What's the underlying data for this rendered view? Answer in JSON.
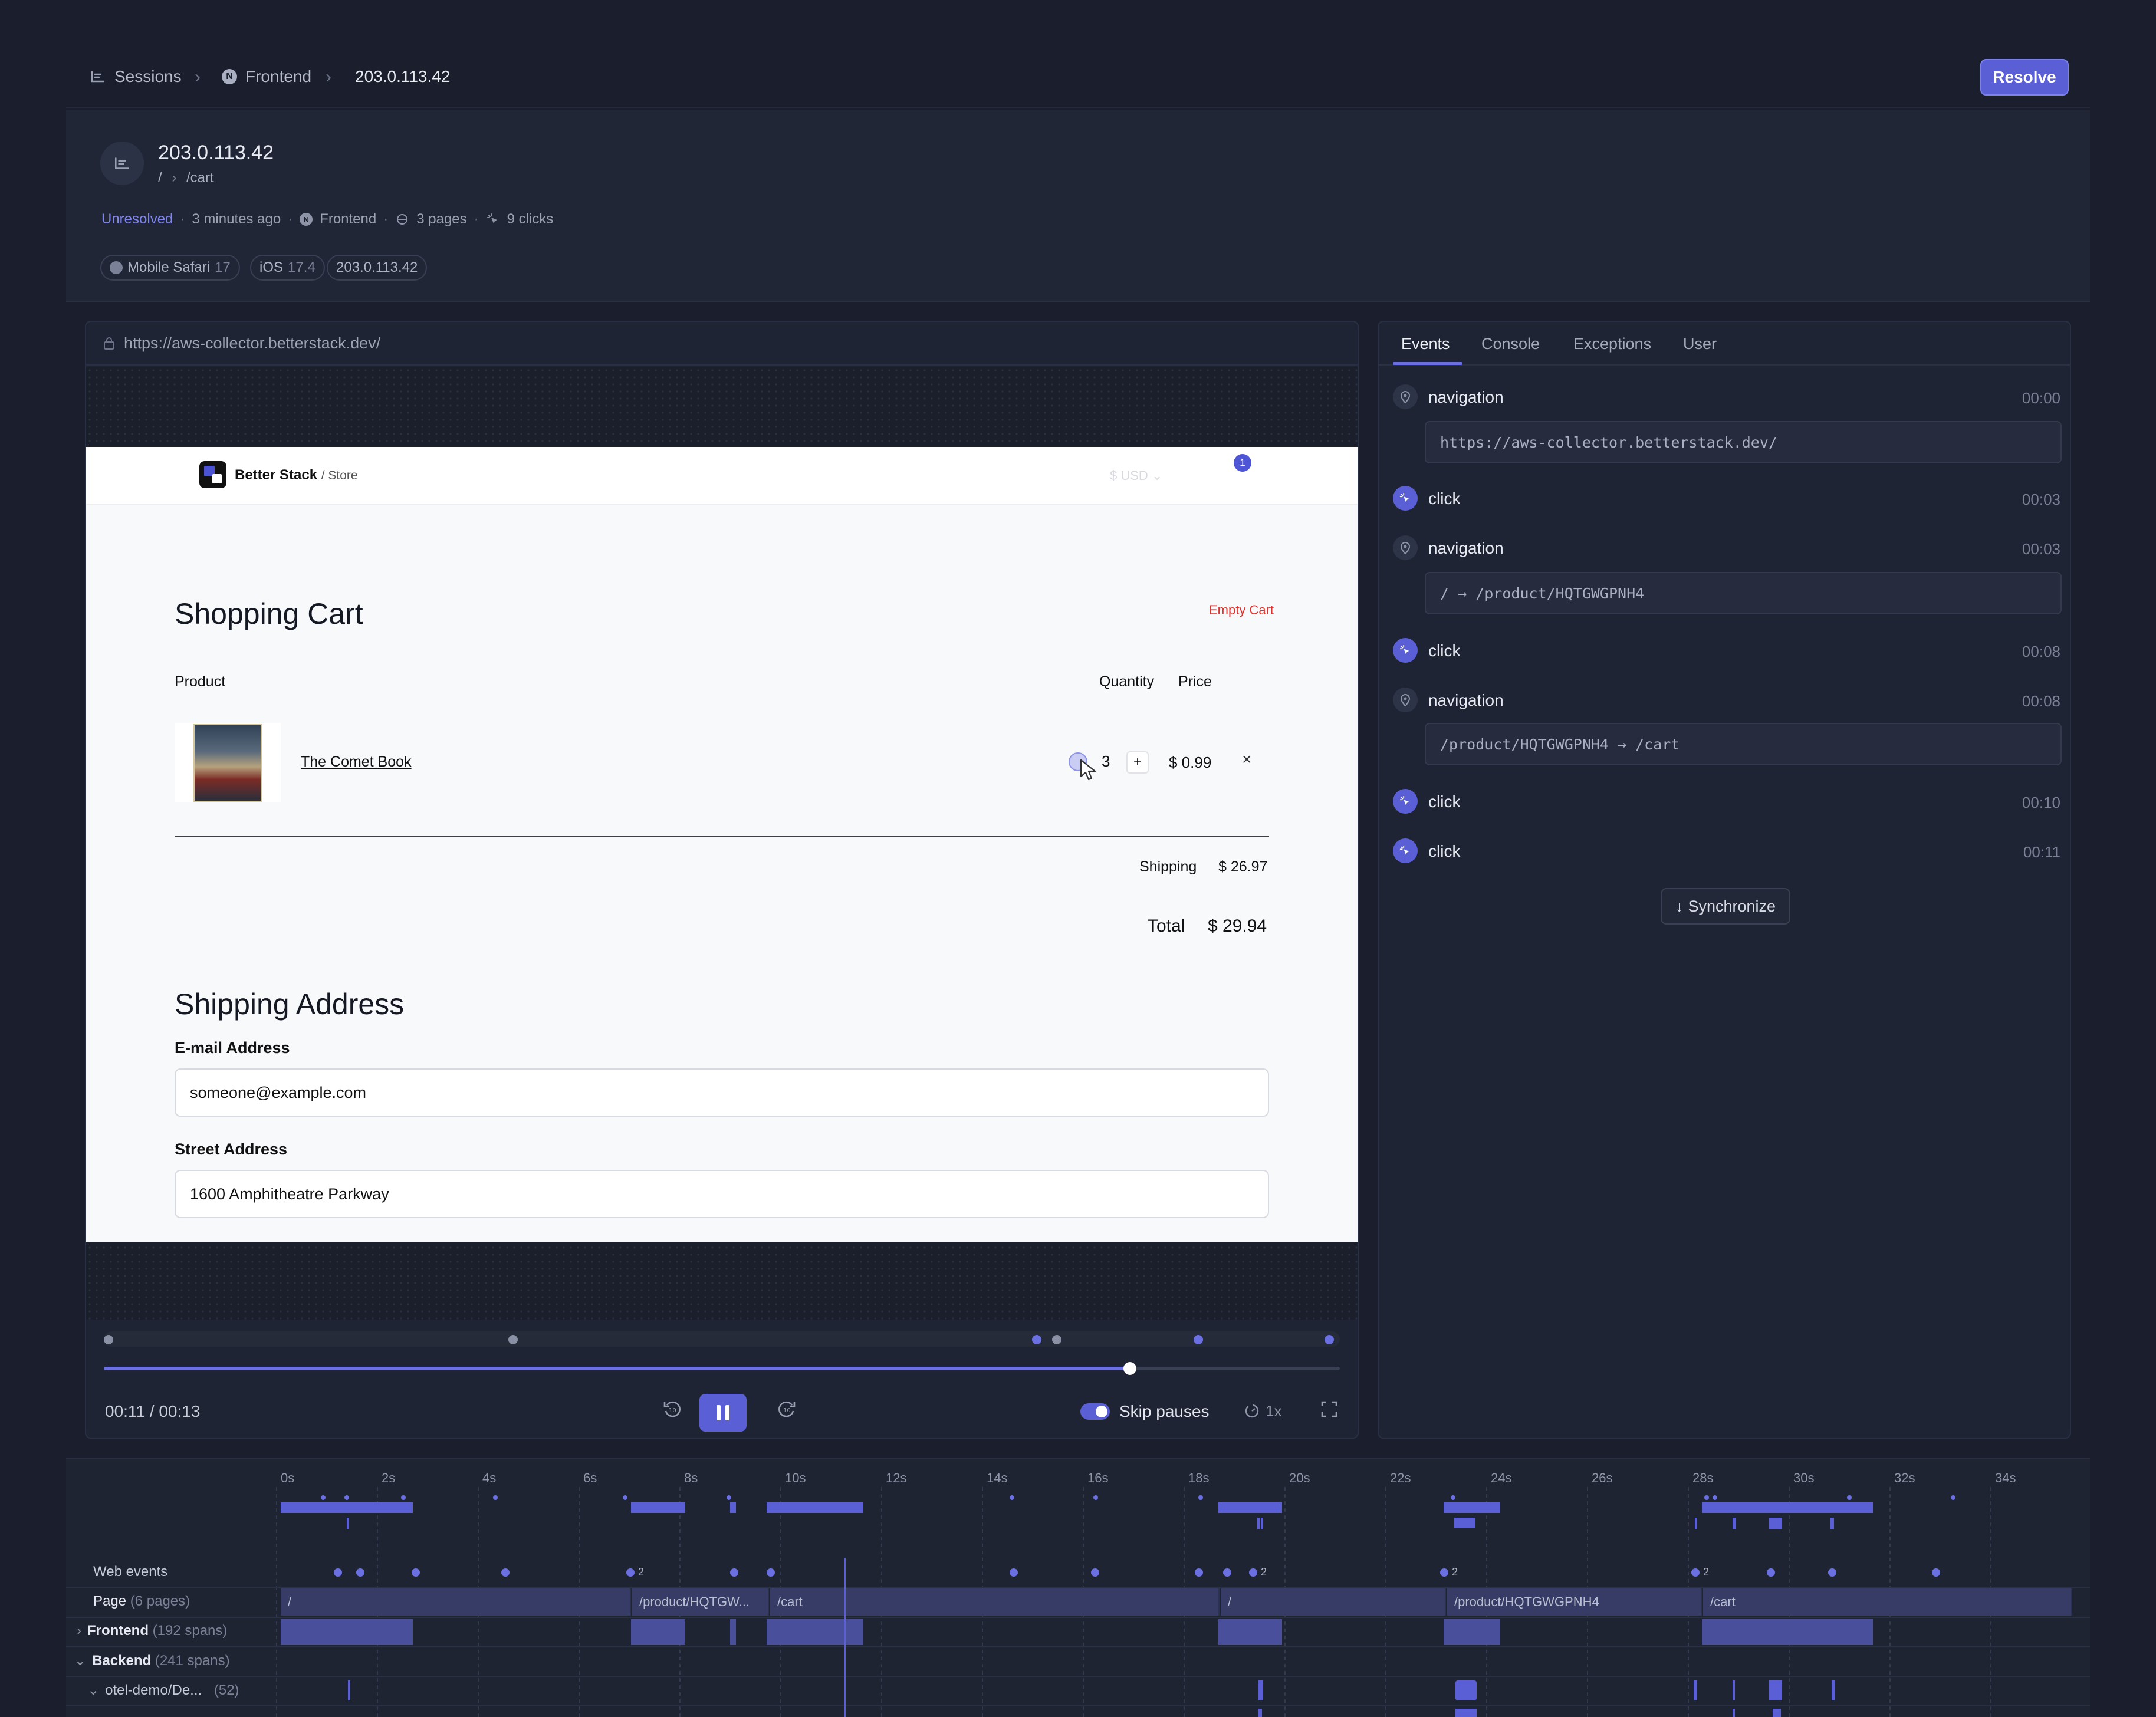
{
  "breadcrumb": {
    "sessions": "Sessions",
    "project": "Frontend",
    "project_initial": "N",
    "current": "203.0.113.42"
  },
  "resolve_label": "Resolve",
  "header": {
    "title": "203.0.113.42",
    "path_root": "/",
    "path_sep": "›",
    "path_current": "/cart",
    "status": "Unresolved",
    "time_ago": "3 minutes ago",
    "project": "Frontend",
    "pages": "3 pages",
    "clicks": "9 clicks",
    "chips": [
      {
        "name": "Mobile Safari",
        "version": "17"
      },
      {
        "name": "iOS",
        "version": "17.4"
      },
      {
        "name": "203.0.113.42",
        "version": ""
      }
    ]
  },
  "player": {
    "url": "https://aws-collector.betterstack.dev/",
    "time": "00:11 / 00:13",
    "skip_pauses": "Skip pauses",
    "speed": "1x",
    "progress": 0.83
  },
  "store": {
    "brand": "Better Stack",
    "brand_sub": "/ Store",
    "currency": "$   USD   ⌄",
    "cart_count": "1",
    "cart_title": "Shopping Cart",
    "empty_cart": "Empty Cart",
    "col_product": "Product",
    "col_quantity": "Quantity",
    "col_price": "Price",
    "item_name": "The Comet Book",
    "item_qty": "3",
    "item_price": "$ 0.99",
    "qty_plus": "+",
    "remove": "×",
    "shipping_label": "Shipping",
    "shipping_value": "$ 26.97",
    "total_label": "Total",
    "total_value": "$ 29.94",
    "address_title": "Shipping Address",
    "email_label": "E-mail Address",
    "email_value": "someone@example.com",
    "street_label": "Street Address",
    "street_value": "1600 Amphitheatre Parkway"
  },
  "tabs": [
    "Events",
    "Console",
    "Exceptions",
    "User"
  ],
  "events": [
    {
      "type": "navigation",
      "time": "00:00",
      "detail": "https://aws-collector.betterstack.dev/"
    },
    {
      "type": "click",
      "time": "00:03",
      "detail": ""
    },
    {
      "type": "navigation",
      "time": "00:03",
      "detail": "/ → /product/HQTGWGPNH4"
    },
    {
      "type": "click",
      "time": "00:08",
      "detail": ""
    },
    {
      "type": "navigation",
      "time": "00:08",
      "detail": "/product/HQTGWGPNH4 → /cart"
    },
    {
      "type": "click",
      "time": "00:10",
      "detail": ""
    },
    {
      "type": "click",
      "time": "00:11",
      "detail": ""
    }
  ],
  "synchronize": "Synchronize",
  "timeline": {
    "ticks": [
      "0s",
      "2s",
      "4s",
      "6s",
      "8s",
      "10s",
      "12s",
      "14s",
      "16s",
      "18s",
      "20s",
      "22s",
      "24s",
      "26s",
      "28s",
      "30s",
      "32s",
      "34s"
    ],
    "rows": {
      "web_events": "Web events",
      "page": "Page",
      "page_count": "(6 pages)",
      "frontend": "Frontend",
      "frontend_count": "(192 spans)",
      "backend": "Backend",
      "backend_count": "(241 spans)",
      "service": "otel-demo/De...",
      "service_count": "(52)"
    },
    "pages": [
      "/",
      "/product/HQTGW...",
      "/cart",
      "/",
      "/product/HQTGWGPNH4",
      "/cart"
    ],
    "badges": [
      "2",
      "2",
      "2",
      "2"
    ]
  },
  "colors": {
    "accent": "#5a5fd6",
    "background": "#1b1f2d",
    "panel": "#1f2434",
    "danger": "#e0312b"
  }
}
